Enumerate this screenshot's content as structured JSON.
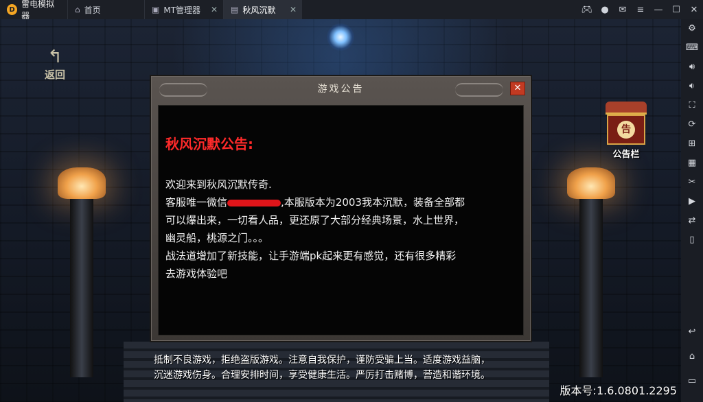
{
  "titlebar": {
    "app_name": "雷电模拟器",
    "tabs": [
      {
        "label": "首页",
        "icon": "home-icon"
      },
      {
        "label": "MT管理器",
        "icon": "app-icon"
      },
      {
        "label": "秋风沉默",
        "icon": "game-icon",
        "active": true
      }
    ],
    "window_controls": [
      "gamepad-icon",
      "avatar-icon",
      "mail-icon",
      "menu-icon",
      "minimize-icon",
      "maximize-icon",
      "close-icon"
    ]
  },
  "sidebar": {
    "buttons": [
      "settings-icon",
      "keyboard-icon",
      "volume-up-icon",
      "volume-down-icon",
      "screenshot-icon",
      "rotate-icon",
      "add-window-icon",
      "apk-icon",
      "scissors-icon",
      "video-icon",
      "sync-icon",
      "phone-icon",
      "back-icon",
      "home-icon",
      "recent-apps-icon"
    ]
  },
  "game": {
    "back_label": "返回",
    "notice_button_label": "公告栏",
    "notice_button_glyph": "告",
    "dialog": {
      "title": "游戏公告",
      "close_glyph": "✕",
      "heading": "秋风沉默公告:",
      "lines": [
        "欢迎来到秋风沉默传奇.",
        "客服唯一微信",
        ",本服版本为2003我本沉默，装备全部都",
        "可以爆出来，一切看人品，更还原了大部分经典场景，水上世界，",
        "幽灵船，桃源之门。。。",
        "战法道增加了新技能，让手游端pk起来更有感觉，还有很多精彩",
        "去游戏体验吧"
      ]
    },
    "health_tips": [
      "抵制不良游戏，拒绝盗版游戏。注意自我保护，谨防受骗上当。适度游戏益脑，",
      "沉迷游戏伤身。合理安排时间，享受健康生活。严厉打击赌博，营造和谐环境。"
    ],
    "version": "版本号:1.6.0801.2295"
  }
}
